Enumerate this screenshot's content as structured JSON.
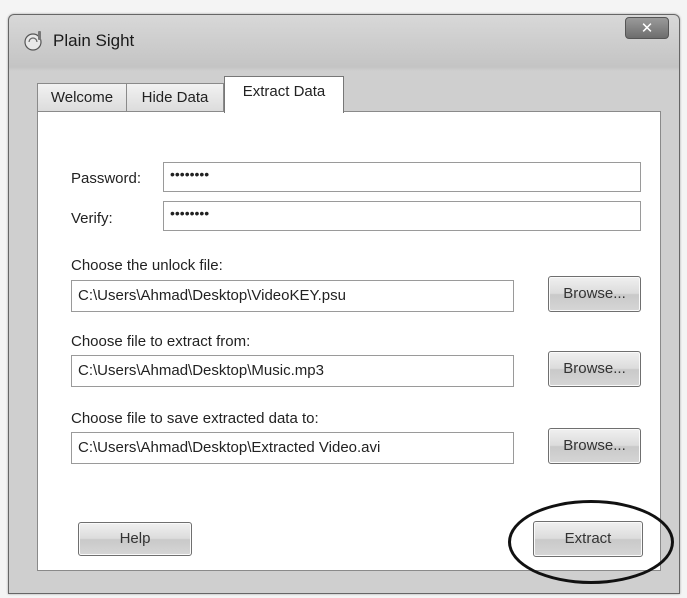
{
  "window": {
    "title": "Plain Sight",
    "close_label": "✕"
  },
  "tabs": [
    {
      "label": "Welcome",
      "active": false
    },
    {
      "label": "Hide Data",
      "active": false
    },
    {
      "label": "Extract Data",
      "active": true
    }
  ],
  "form": {
    "password_label": "Password:",
    "password_value": "••••••••",
    "verify_label": "Verify:",
    "verify_value": "••••••••",
    "unlock_file_label": "Choose the unlock file:",
    "unlock_file_value": "C:\\Users\\Ahmad\\Desktop\\VideoKEY.psu",
    "extract_from_label": "Choose file to extract from:",
    "extract_from_value": "C:\\Users\\Ahmad\\Desktop\\Music.mp3",
    "save_to_label": "Choose file to save extracted data to:",
    "save_to_value": "C:\\Users\\Ahmad\\Desktop\\Extracted Video.avi",
    "browse_label": "Browse..."
  },
  "buttons": {
    "help_label": "Help",
    "extract_label": "Extract"
  },
  "annotation": {
    "highlight_target": "Extract"
  }
}
